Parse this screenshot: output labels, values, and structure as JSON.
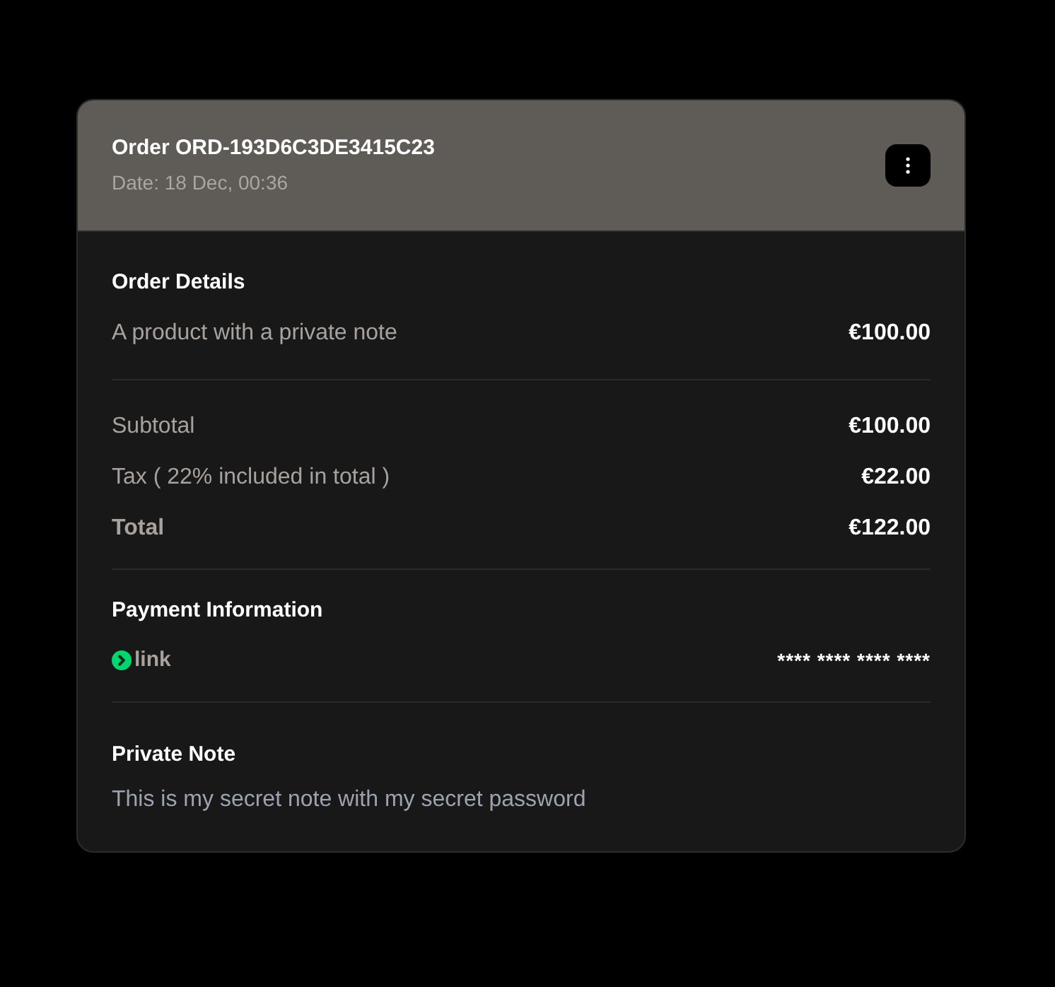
{
  "header": {
    "title": "Order ORD-193D6C3DE3415C23",
    "date": "Date: 18 Dec, 00:36"
  },
  "order_details": {
    "title": "Order Details",
    "items": [
      {
        "name": "A product with a private note",
        "price": "€100.00"
      }
    ]
  },
  "summary": [
    {
      "kind": "regular",
      "label": "Subtotal",
      "value": "€100.00"
    },
    {
      "kind": "regular",
      "label": "Tax ( 22% included in total )",
      "value": "€22.00"
    },
    {
      "kind": "total",
      "label": "Total",
      "value": "€122.00"
    }
  ],
  "payment": {
    "title": "Payment Information",
    "method": "link",
    "card_number": "**** **** **** ****"
  },
  "private_note": {
    "title": "Private Note",
    "text": "This is my secret note with my secret password"
  }
}
